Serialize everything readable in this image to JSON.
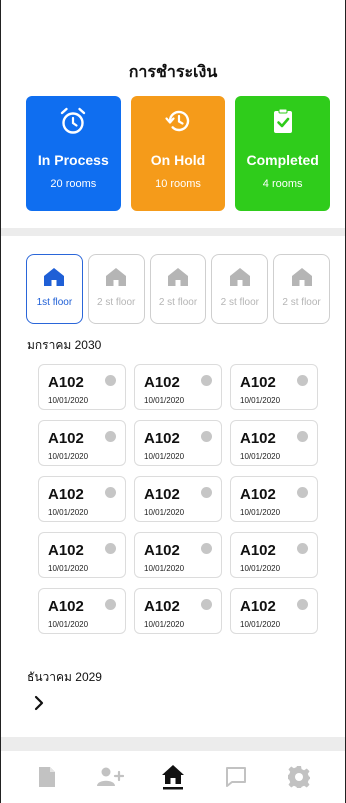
{
  "header": {
    "title": "การชำระเงิน"
  },
  "status_cards": [
    {
      "id": "in-process",
      "title": "In Process",
      "count": "20 rooms",
      "color": "#0f6ef0",
      "icon": "alarm-clock-icon"
    },
    {
      "id": "on-hold",
      "title": "On Hold",
      "count": "10 rooms",
      "color": "#f59b1a",
      "icon": "history-icon"
    },
    {
      "id": "completed",
      "title": "Completed",
      "count": "4 rooms",
      "color": "#2fcc1b",
      "icon": "clipboard-check-icon"
    }
  ],
  "floors": [
    {
      "label": "1st floor",
      "active": true
    },
    {
      "label": "2 st floor",
      "active": false
    },
    {
      "label": "2 st floor",
      "active": false
    },
    {
      "label": "2 st floor",
      "active": false
    },
    {
      "label": "2 st floor",
      "active": false
    }
  ],
  "months": [
    {
      "label": "มกราคม 2030"
    },
    {
      "label": "ธันวาคม 2029"
    }
  ],
  "rooms": [
    {
      "code": "A102",
      "date": "10/01/2020"
    },
    {
      "code": "A102",
      "date": "10/01/2020"
    },
    {
      "code": "A102",
      "date": "10/01/2020"
    },
    {
      "code": "A102",
      "date": "10/01/2020"
    },
    {
      "code": "A102",
      "date": "10/01/2020"
    },
    {
      "code": "A102",
      "date": "10/01/2020"
    },
    {
      "code": "A102",
      "date": "10/01/2020"
    },
    {
      "code": "A102",
      "date": "10/01/2020"
    },
    {
      "code": "A102",
      "date": "10/01/2020"
    },
    {
      "code": "A102",
      "date": "10/01/2020"
    },
    {
      "code": "A102",
      "date": "10/01/2020"
    },
    {
      "code": "A102",
      "date": "10/01/2020"
    },
    {
      "code": "A102",
      "date": "10/01/2020"
    },
    {
      "code": "A102",
      "date": "10/01/2020"
    },
    {
      "code": "A102",
      "date": "10/01/2020"
    }
  ],
  "bottom_nav": [
    {
      "icon": "document-icon",
      "active": false
    },
    {
      "icon": "add-user-icon",
      "active": false
    },
    {
      "icon": "home-icon",
      "active": true
    },
    {
      "icon": "chat-icon",
      "active": false
    },
    {
      "icon": "settings-icon",
      "active": false
    }
  ],
  "colors": {
    "active_blue": "#1f5fd6",
    "inactive_gray": "#b5b5b5",
    "dot_gray": "#c6c6c6"
  }
}
